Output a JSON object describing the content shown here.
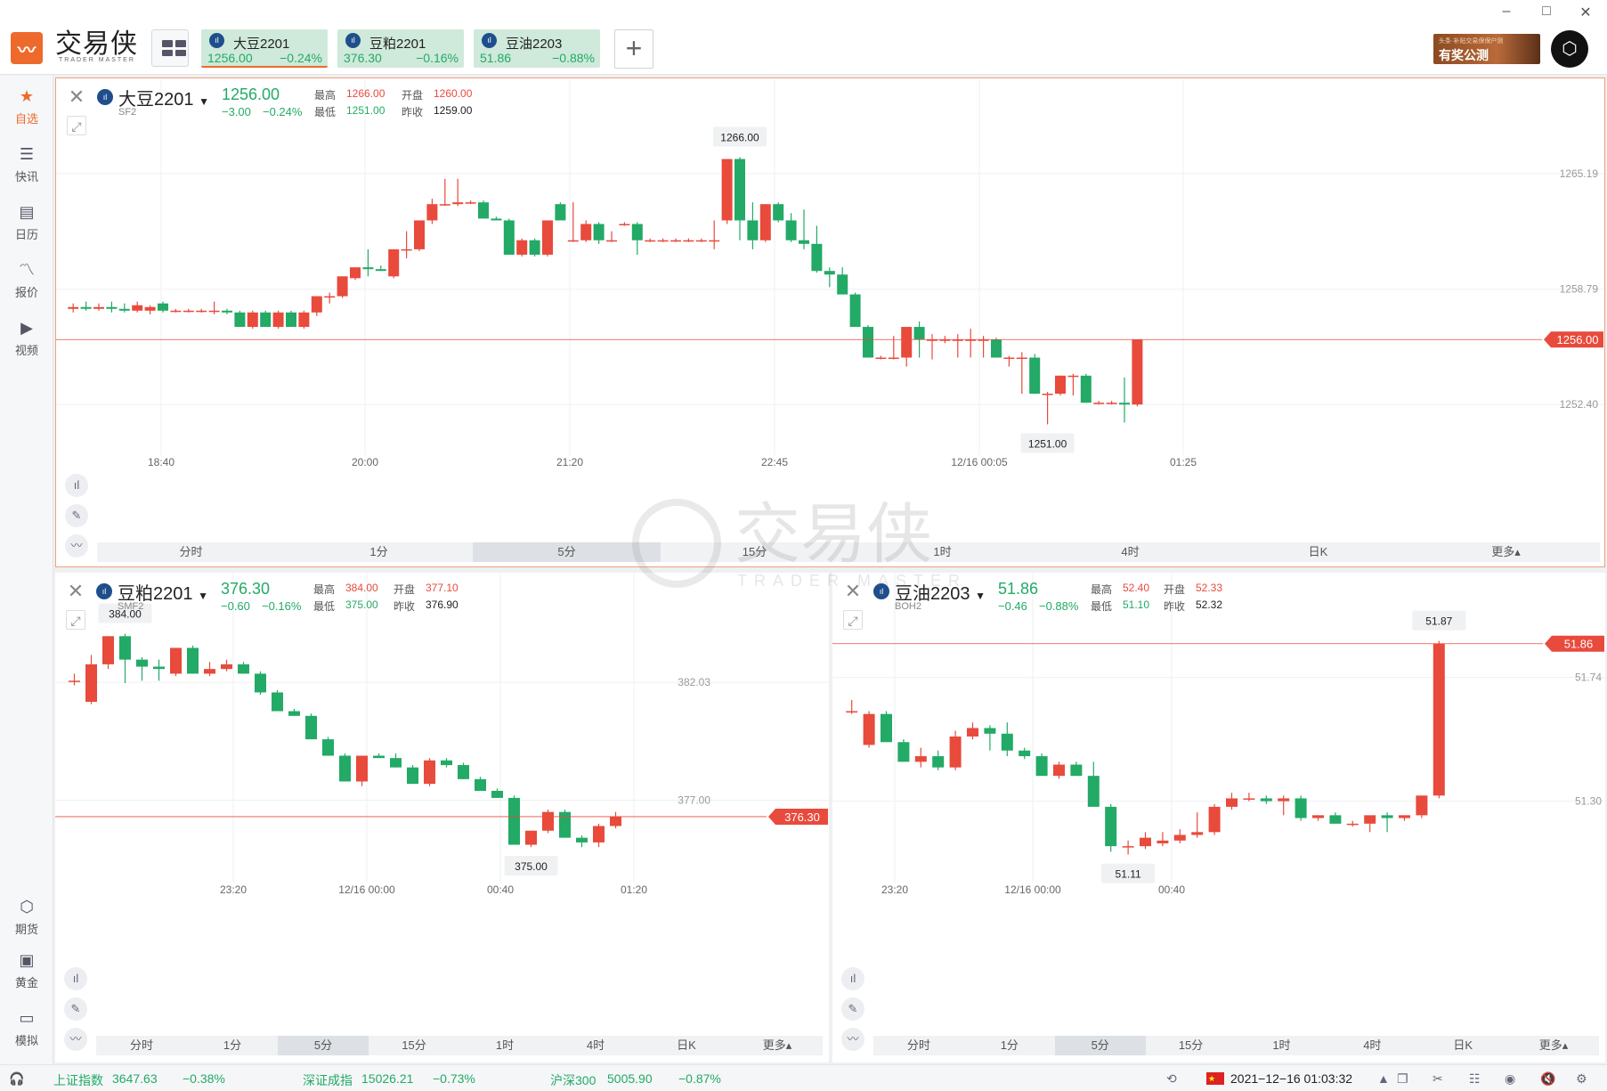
{
  "app": {
    "logo_text": "交易侠",
    "logo_sub": "TRADER MASTER",
    "watermark": "交易侠",
    "watermark_sub": "TRADER MASTER"
  },
  "window": {
    "minimize": "–",
    "maximize": "□",
    "close": "✕"
  },
  "tabs": [
    {
      "name": "大豆2201",
      "price": "1256.00",
      "change": "−0.24%",
      "active": true
    },
    {
      "name": "豆粕2201",
      "price": "376.30",
      "change": "−0.16%",
      "active": false
    },
    {
      "name": "豆油2203",
      "price": "51.86",
      "change": "−0.88%",
      "active": false
    }
  ],
  "ad": {
    "small": "头条·补贴交易保保户测",
    "big": "有奖公测"
  },
  "sidebar": {
    "top": [
      {
        "label": "自选",
        "icon": "star-bookmark-icon"
      },
      {
        "label": "快讯",
        "icon": "news-list-icon"
      },
      {
        "label": "日历",
        "icon": "calendar-icon"
      },
      {
        "label": "报价",
        "icon": "trend-line-icon"
      },
      {
        "label": "视频",
        "icon": "video-play-icon"
      }
    ],
    "bottom": [
      {
        "label": "期货",
        "icon": "futures-hexagon-icon"
      },
      {
        "label": "黄金",
        "icon": "gold-exchange-icon"
      },
      {
        "label": "模拟",
        "icon": "wallet-icon"
      }
    ]
  },
  "stat_labels": {
    "high": "最高",
    "low": "最低",
    "open": "开盘",
    "prev_close": "昨收"
  },
  "timeframes": [
    "分时",
    "1分",
    "5分",
    "15分",
    "1时",
    "4时",
    "日K",
    "更多▴"
  ],
  "active_timeframe": "5分",
  "colors": {
    "up": "#e84a3c",
    "down": "#22aa66",
    "accent": "#ee6a2c"
  },
  "panels": [
    {
      "name": "大豆2201",
      "code": "SF2",
      "price": "1256.00",
      "change": "−3.00",
      "change_pct": "−0.24%",
      "high": "1266.00",
      "low": "1251.00",
      "open": "1260.00",
      "prev_close": "1259.00",
      "current_label": "1256.00",
      "max_label": "1266.00",
      "min_label": "1251.00"
    },
    {
      "name": "豆粕2201",
      "code": "SMF2",
      "price": "376.30",
      "change": "−0.60",
      "change_pct": "−0.16%",
      "high": "384.00",
      "low": "375.00",
      "open": "377.10",
      "prev_close": "376.90",
      "current_label": "376.30",
      "max_label": "384.00",
      "min_label": "375.00"
    },
    {
      "name": "豆油2203",
      "code": "BOH2",
      "price": "51.86",
      "change": "−0.46",
      "change_pct": "−0.88%",
      "high": "52.40",
      "low": "51.10",
      "open": "52.33",
      "prev_close": "52.32",
      "current_label": "51.86",
      "max_label": "51.87",
      "min_label": "51.11"
    }
  ],
  "status": {
    "sh_name": "上证指数",
    "sh_val": "3647.63",
    "sh_chg": "−0.38%",
    "sz_name": "深证成指",
    "sz_val": "15026.21",
    "sz_chg": "−0.73%",
    "hs_name": "沪深300",
    "hs_val": "5005.90",
    "hs_chg": "−0.87%",
    "datetime": "2021−12−16 01:03:32"
  },
  "chart_data": [
    {
      "type": "candlestick",
      "title": "大豆2201",
      "x_labels": [
        "18:40",
        "20:00",
        "21:20",
        "22:45",
        "12/16 00:05",
        "01:25"
      ],
      "y_ticks": [
        "1265.19",
        "1258.79",
        "1252.40"
      ],
      "ylim": [
        1249.5,
        1268.0
      ],
      "current": 1256.0,
      "ohlc": [
        [
          1257.7,
          1258.0,
          1257.5,
          1257.8
        ],
        [
          1257.8,
          1258.1,
          1257.6,
          1257.7
        ],
        [
          1257.7,
          1258.0,
          1257.6,
          1257.8
        ],
        [
          1257.8,
          1258.1,
          1257.5,
          1257.7
        ],
        [
          1257.7,
          1258.0,
          1257.5,
          1257.6
        ],
        [
          1257.6,
          1258.1,
          1257.5,
          1257.9
        ],
        [
          1257.6,
          1257.9,
          1257.4,
          1257.8
        ],
        [
          1258.0,
          1258.1,
          1257.5,
          1257.6
        ],
        [
          1257.6,
          1257.7,
          1257.5,
          1257.6
        ],
        [
          1257.6,
          1257.7,
          1257.5,
          1257.6
        ],
        [
          1257.6,
          1257.7,
          1257.5,
          1257.6
        ],
        [
          1257.6,
          1258.1,
          1257.4,
          1257.6
        ],
        [
          1257.6,
          1257.7,
          1257.4,
          1257.5
        ],
        [
          1257.5,
          1257.6,
          1256.7,
          1256.7
        ],
        [
          1256.7,
          1257.6,
          1256.6,
          1257.5
        ],
        [
          1257.5,
          1257.6,
          1256.7,
          1256.7
        ],
        [
          1256.7,
          1257.6,
          1256.6,
          1257.5
        ],
        [
          1257.5,
          1257.6,
          1256.7,
          1256.7
        ],
        [
          1256.7,
          1257.6,
          1256.6,
          1257.5
        ],
        [
          1257.5,
          1258.4,
          1257.3,
          1258.4
        ],
        [
          1258.4,
          1258.6,
          1258.0,
          1258.4
        ],
        [
          1258.4,
          1259.5,
          1258.3,
          1259.5
        ],
        [
          1259.4,
          1260.0,
          1259.3,
          1260.0
        ],
        [
          1260.0,
          1261.0,
          1259.5,
          1259.9
        ],
        [
          1259.9,
          1260.1,
          1259.8,
          1259.8
        ],
        [
          1259.5,
          1261.0,
          1259.4,
          1261.0
        ],
        [
          1261.0,
          1262.0,
          1260.5,
          1261.0
        ],
        [
          1261.0,
          1262.6,
          1260.9,
          1262.6
        ],
        [
          1262.6,
          1263.8,
          1262.4,
          1263.5
        ],
        [
          1263.5,
          1264.9,
          1263.4,
          1263.5
        ],
        [
          1263.5,
          1264.9,
          1263.4,
          1263.6
        ],
        [
          1263.6,
          1263.7,
          1263.5,
          1263.6
        ],
        [
          1263.6,
          1263.7,
          1263.5,
          1262.7
        ],
        [
          1262.7,
          1262.8,
          1262.6,
          1262.6
        ],
        [
          1262.6,
          1262.7,
          1260.7,
          1260.7
        ],
        [
          1260.7,
          1261.6,
          1260.6,
          1261.5
        ],
        [
          1261.5,
          1261.6,
          1260.6,
          1260.7
        ],
        [
          1260.7,
          1262.6,
          1260.6,
          1262.6
        ],
        [
          1263.5,
          1263.6,
          1263.4,
          1262.6
        ],
        [
          1261.5,
          1263.6,
          1261.4,
          1261.5
        ],
        [
          1261.5,
          1262.6,
          1261.4,
          1262.4
        ],
        [
          1262.4,
          1262.5,
          1261.3,
          1261.5
        ],
        [
          1261.5,
          1262.0,
          1261.4,
          1261.5
        ],
        [
          1262.4,
          1262.5,
          1262.3,
          1262.4
        ],
        [
          1262.4,
          1262.5,
          1260.7,
          1261.5
        ],
        [
          1261.5,
          1261.6,
          1261.4,
          1261.5
        ],
        [
          1261.5,
          1261.6,
          1261.4,
          1261.5
        ],
        [
          1261.5,
          1261.6,
          1261.4,
          1261.5
        ],
        [
          1261.5,
          1261.6,
          1261.4,
          1261.5
        ],
        [
          1261.5,
          1261.6,
          1261.4,
          1261.5
        ],
        [
          1261.5,
          1262.6,
          1261.0,
          1261.5
        ],
        [
          1262.6,
          1266.0,
          1262.4,
          1266.0
        ],
        [
          1266.0,
          1266.1,
          1261.5,
          1262.6
        ],
        [
          1262.6,
          1263.6,
          1261.0,
          1261.5
        ],
        [
          1261.5,
          1263.5,
          1261.4,
          1263.5
        ],
        [
          1263.5,
          1263.6,
          1262.5,
          1262.6
        ],
        [
          1262.6,
          1263.0,
          1261.4,
          1261.5
        ],
        [
          1261.5,
          1263.2,
          1261.0,
          1261.3
        ],
        [
          1261.3,
          1262.3,
          1259.7,
          1259.8
        ],
        [
          1259.8,
          1260.0,
          1258.9,
          1259.6
        ],
        [
          1259.6,
          1260.0,
          1258.5,
          1258.5
        ],
        [
          1258.5,
          1258.6,
          1256.7,
          1256.7
        ],
        [
          1256.7,
          1256.8,
          1255.0,
          1255.0
        ],
        [
          1255.0,
          1255.1,
          1254.9,
          1255.0
        ],
        [
          1255.0,
          1256.2,
          1254.9,
          1255.0
        ],
        [
          1255.0,
          1255.8,
          1254.5,
          1256.7
        ],
        [
          1256.7,
          1257.0,
          1255.0,
          1256.0
        ],
        [
          1256.0,
          1256.3,
          1254.9,
          1256.0
        ],
        [
          1256.0,
          1256.2,
          1255.8,
          1256.0
        ],
        [
          1256.0,
          1256.3,
          1255.0,
          1256.0
        ],
        [
          1256.0,
          1256.6,
          1255.0,
          1256.0
        ],
        [
          1256.0,
          1256.2,
          1255.0,
          1256.0
        ],
        [
          1256.0,
          1256.1,
          1255.0,
          1255.0
        ],
        [
          1255.0,
          1255.1,
          1254.5,
          1255.0
        ],
        [
          1255.0,
          1255.3,
          1253.0,
          1255.0
        ],
        [
          1255.0,
          1255.2,
          1253.0,
          1253.0
        ],
        [
          1253.0,
          1253.1,
          1251.3,
          1253.0
        ],
        [
          1253.0,
          1254.0,
          1252.9,
          1254.0
        ],
        [
          1254.0,
          1254.1,
          1252.9,
          1254.0
        ],
        [
          1254.0,
          1254.1,
          1252.5,
          1252.5
        ],
        [
          1252.5,
          1252.6,
          1252.4,
          1252.5
        ],
        [
          1252.5,
          1252.6,
          1252.4,
          1252.5
        ],
        [
          1252.5,
          1253.9,
          1251.4,
          1252.4
        ],
        [
          1252.4,
          1256.0,
          1252.3,
          1256.0
        ]
      ]
    },
    {
      "type": "candlestick",
      "title": "豆粕2201",
      "x_labels": [
        "23:20",
        "12/16 00:00",
        "00:40",
        "01:20"
      ],
      "y_ticks": [
        "382.03",
        "377.00"
      ],
      "ylim": [
        373.6,
        385.0
      ],
      "current": 376.3,
      "ohlc": [
        [
          382.1,
          382.4,
          381.9,
          382.1
        ],
        [
          381.2,
          383.2,
          381.1,
          382.8
        ],
        [
          382.8,
          384.0,
          382.6,
          384.0
        ],
        [
          384.0,
          384.1,
          382.0,
          383.0
        ],
        [
          383.0,
          383.1,
          382.1,
          382.7
        ],
        [
          382.7,
          383.0,
          382.1,
          382.6
        ],
        [
          382.4,
          383.4,
          382.3,
          383.5
        ],
        [
          383.5,
          383.6,
          382.4,
          382.4
        ],
        [
          382.4,
          382.9,
          382.3,
          382.6
        ],
        [
          382.6,
          383.0,
          382.5,
          382.8
        ],
        [
          382.8,
          382.9,
          382.4,
          382.4
        ],
        [
          382.4,
          382.5,
          381.5,
          381.6
        ],
        [
          381.6,
          381.7,
          380.8,
          380.8
        ],
        [
          380.8,
          380.9,
          380.6,
          380.6
        ],
        [
          380.6,
          380.7,
          379.6,
          379.6
        ],
        [
          379.6,
          379.7,
          378.9,
          378.9
        ],
        [
          378.9,
          379.0,
          377.8,
          377.8
        ],
        [
          377.8,
          377.9,
          377.6,
          378.9
        ],
        [
          378.9,
          379.0,
          378.8,
          378.8
        ],
        [
          378.8,
          379.0,
          378.4,
          378.4
        ],
        [
          378.4,
          378.5,
          377.7,
          377.7
        ],
        [
          377.7,
          378.8,
          377.6,
          378.7
        ],
        [
          378.7,
          378.8,
          378.4,
          378.5
        ],
        [
          378.5,
          378.6,
          377.9,
          377.9
        ],
        [
          377.9,
          378.0,
          377.4,
          377.4
        ],
        [
          377.4,
          377.5,
          377.1,
          377.1
        ],
        [
          377.1,
          377.2,
          375.1,
          375.1
        ],
        [
          375.1,
          375.7,
          375.0,
          375.7
        ],
        [
          375.7,
          376.6,
          375.6,
          376.5
        ],
        [
          376.5,
          376.6,
          375.4,
          375.4
        ],
        [
          375.4,
          375.5,
          375.0,
          375.2
        ],
        [
          375.2,
          376.0,
          375.0,
          375.9
        ],
        [
          375.9,
          376.5,
          375.8,
          376.3
        ]
      ]
    },
    {
      "type": "candlestick",
      "title": "豆油2203",
      "x_labels": [
        "23:20",
        "12/16 00:00",
        "00:40"
      ],
      "y_ticks": [
        "51.74",
        "51.30"
      ],
      "ylim": [
        51.02,
        51.97
      ],
      "current": 51.86,
      "ohlc": [
        [
          51.62,
          51.66,
          51.61,
          51.62
        ],
        [
          51.5,
          51.62,
          51.49,
          51.61
        ],
        [
          51.61,
          51.62,
          51.51,
          51.51
        ],
        [
          51.51,
          51.52,
          51.44,
          51.44
        ],
        [
          51.44,
          51.49,
          51.42,
          51.46
        ],
        [
          51.46,
          51.48,
          51.41,
          51.42
        ],
        [
          51.42,
          51.55,
          51.41,
          51.53
        ],
        [
          51.53,
          51.58,
          51.52,
          51.56
        ],
        [
          51.56,
          51.57,
          51.48,
          51.54
        ],
        [
          51.54,
          51.58,
          51.46,
          51.48
        ],
        [
          51.48,
          51.49,
          51.45,
          51.46
        ],
        [
          51.46,
          51.47,
          51.39,
          51.39
        ],
        [
          51.39,
          51.44,
          51.38,
          51.43
        ],
        [
          51.43,
          51.44,
          51.39,
          51.39
        ],
        [
          51.39,
          51.44,
          51.32,
          51.28
        ],
        [
          51.28,
          51.29,
          51.12,
          51.14
        ],
        [
          51.14,
          51.16,
          51.11,
          51.14
        ],
        [
          51.14,
          51.19,
          51.13,
          51.17
        ],
        [
          51.15,
          51.19,
          51.14,
          51.16
        ],
        [
          51.16,
          51.2,
          51.15,
          51.18
        ],
        [
          51.18,
          51.26,
          51.17,
          51.19
        ],
        [
          51.19,
          51.29,
          51.18,
          51.28
        ],
        [
          51.28,
          51.33,
          51.27,
          51.31
        ],
        [
          51.31,
          51.33,
          51.3,
          51.31
        ],
        [
          51.31,
          51.32,
          51.29,
          51.3
        ],
        [
          51.3,
          51.32,
          51.25,
          51.31
        ],
        [
          51.31,
          51.32,
          51.23,
          51.24
        ],
        [
          51.24,
          51.25,
          51.23,
          51.25
        ],
        [
          51.25,
          51.26,
          51.22,
          51.22
        ],
        [
          51.22,
          51.23,
          51.21,
          51.22
        ],
        [
          51.22,
          51.24,
          51.19,
          51.25
        ],
        [
          51.25,
          51.26,
          51.19,
          51.24
        ],
        [
          51.24,
          51.25,
          51.23,
          51.25
        ],
        [
          51.25,
          51.32,
          51.24,
          51.32
        ],
        [
          51.32,
          51.87,
          51.31,
          51.86
        ]
      ]
    }
  ]
}
